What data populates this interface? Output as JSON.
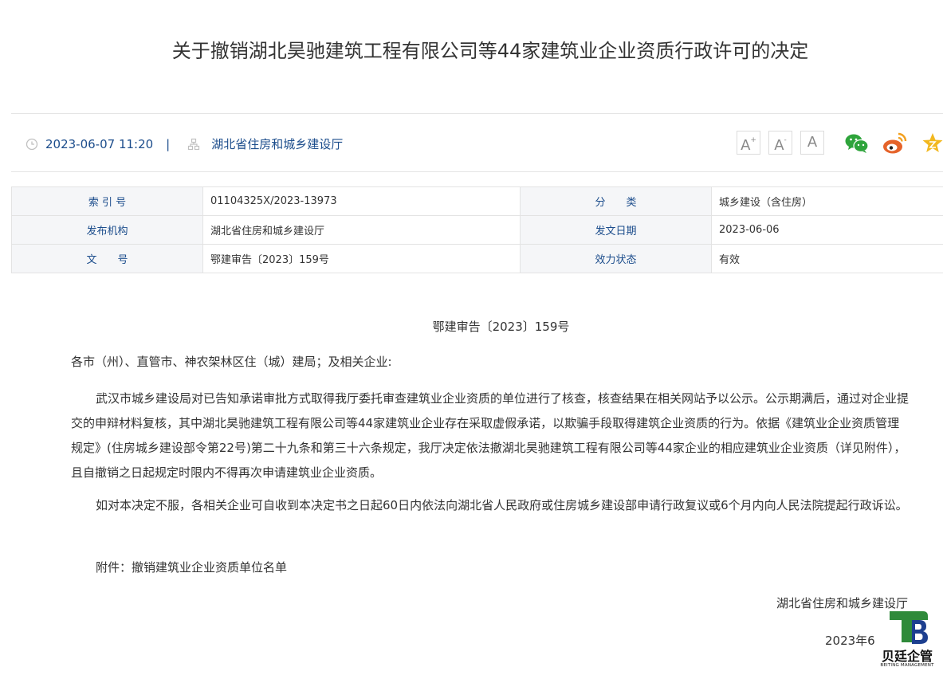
{
  "header": {
    "title": "关于撤销湖北昊驰建筑工程有限公司等44家建筑业企业资质行政许可的决定"
  },
  "meta": {
    "datetime": "2023-06-07 11:20",
    "separator": "|",
    "publisher": "湖北省住房和城乡建设厅",
    "font_buttons": [
      "A",
      "A",
      "A"
    ],
    "icons": [
      "clock-icon",
      "org-icon",
      "wechat-icon",
      "weibo-icon",
      "favorite-icon"
    ],
    "colors": {
      "link": "#1c4d8c",
      "wechat": "#2ea43b",
      "weibo": "#e5632a",
      "star": "#f2b81f"
    }
  },
  "info_table": {
    "rows": [
      {
        "label1": "索 引 号",
        "value1": "01104325X/2023-13973",
        "label2": "分　　类",
        "value2": "城乡建设（含住房）"
      },
      {
        "label1": "发布机构",
        "value1": "湖北省住房和城乡建设厅",
        "label2": "发文日期",
        "value2": "2023-06-06"
      },
      {
        "label1": "文　　号",
        "value1": "鄂建审告〔2023〕159号",
        "label2": "效力状态",
        "value2": "有效"
      }
    ]
  },
  "body": {
    "doc_number": "鄂建审告〔2023〕159号",
    "salutation": "各市（州）、直管市、神农架林区住（城）建局；及相关企业:",
    "paragraph1": "武汉市城乡建设局对已告知承诺审批方式取得我厅委托审查建筑业企业资质的单位进行了核查，核查结果在相关网站予以公示。公示期满后，通过对企业提交的申辩材料复核，其中湖北昊驰建筑工程有限公司等44家建筑业企业存在采取虚假承诺，以欺骗手段取得建筑企业资质的行为。依据《建筑业企业资质管理规定》(住房城乡建设部令第22号)第二十九条和第三十六条规定，我厅决定依法撤湖北昊驰建筑工程有限公司等44家企业的相应建筑业企业资质（详见附件），且自撤销之日起规定时限内不得再次申请建筑业企业资质。",
    "paragraph2": "如对本决定不服，各相关企业可自收到本决定书之日起60日内依法向湖北省人民政府或住房城乡建设部申请行政复议或6个月内向人民法院提起行政诉讼。",
    "attachment": "附件：撤销建筑业企业资质单位名单",
    "signature": "湖北省住房和城乡建设厅",
    "sign_date": "2023年6月"
  },
  "watermark": {
    "name": "贝廷企管",
    "sub": "BEITING MANAGEMENT",
    "colors": {
      "green": "#2f8a3a",
      "blue": "#1d3f8f"
    }
  }
}
